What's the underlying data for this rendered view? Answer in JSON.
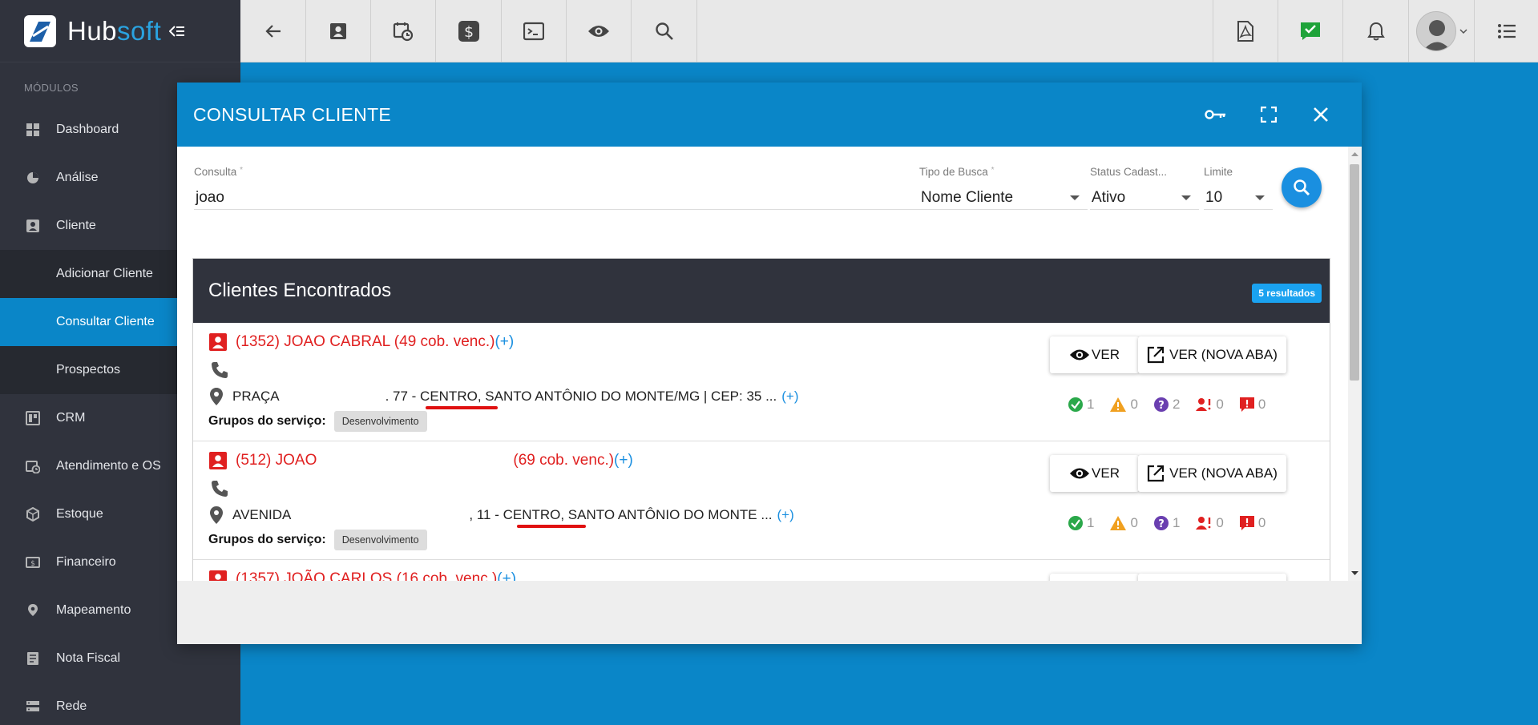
{
  "brand": {
    "hub": "Hub",
    "soft": "soft"
  },
  "sidebar": {
    "section_label": "MÓDULOS",
    "items": [
      {
        "label": "Dashboard"
      },
      {
        "label": "Análise"
      },
      {
        "label": "Cliente"
      },
      {
        "label": "Adicionar Cliente"
      },
      {
        "label": "Consultar Cliente"
      },
      {
        "label": "Prospectos"
      },
      {
        "label": "CRM"
      },
      {
        "label": "Atendimento e OS"
      },
      {
        "label": "Estoque"
      },
      {
        "label": "Financeiro"
      },
      {
        "label": "Mapeamento"
      },
      {
        "label": "Nota Fiscal"
      },
      {
        "label": "Rede"
      }
    ]
  },
  "modal": {
    "title": "CONSULTAR CLIENTE",
    "form": {
      "consulta_label": "Consulta",
      "consulta_value": "joao",
      "tipo_label": "Tipo de Busca",
      "tipo_value": "Nome Cliente",
      "status_label": "Status Cadast...",
      "status_value": "Ativo",
      "limite_label": "Limite",
      "limite_value": "10",
      "required_mark": "*"
    },
    "results": {
      "title": "Clientes Encontrados",
      "badge": "5 resultados",
      "grupos_label": "Grupos do serviço:",
      "ver_label": "VER",
      "ver_nova_label": "VER (NOVA ABA)",
      "plus": "(+)",
      "items": [
        {
          "name": "(1352) JOAO CABRAL (49 cob. venc.)",
          "address_start": "PRAÇA",
          "address_rest": ". 77 - CENTRO, SANTO ANTÔNIO DO MONTE/MG | CEP: 35 ...",
          "group": "Desenvolvimento",
          "stats": [
            "1",
            "0",
            "2",
            "0",
            "0"
          ]
        },
        {
          "name": "(512) JOAO",
          "name_suffix": "(69 cob. venc.)",
          "address_start": "AVENIDA",
          "address_rest": ", 11 - CENTRO, SANTO ANTÔNIO DO MONTE ...",
          "group": "Desenvolvimento",
          "stats": [
            "1",
            "0",
            "1",
            "0",
            "0"
          ]
        },
        {
          "name": "(1357) JOÃO CARLOS (16 cob. venc.)"
        }
      ]
    }
  },
  "colors": {
    "accent": "#0a86c8",
    "sidebar": "#30333d",
    "danger": "#e02020",
    "link": "#1a8fe0"
  }
}
